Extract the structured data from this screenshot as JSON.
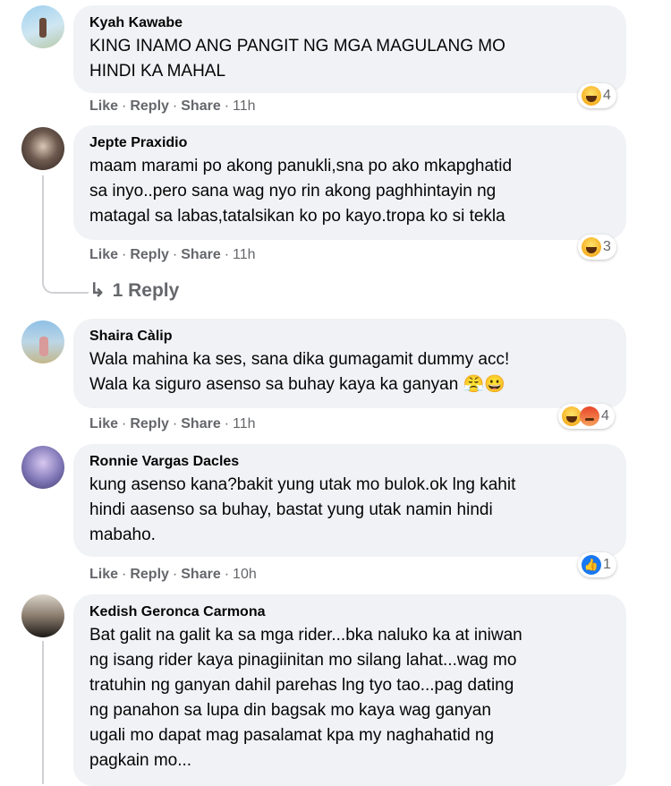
{
  "comments": [
    {
      "name": "Kyah Kawabe",
      "text": "KING INAMO ANG PANGIT NG MGA MAGULANG MO\nHINDI KA MAHAL",
      "like": "Like",
      "reply": "Reply",
      "share": "Share",
      "time": "11h",
      "reaction_count": "4",
      "reaction_icons": [
        "haha-icon"
      ]
    },
    {
      "name": "Jepte Praxidio",
      "text": "maam marami po akong panukli,sna po ako mkapghatid\nsa inyo..pero sana wag nyo rin akong paghhintayin ng\nmatagal sa labas,tatalsikan ko po kayo.tropa ko si tekla",
      "like": "Like",
      "reply": "Reply",
      "share": "Share",
      "time": "11h",
      "reaction_count": "3",
      "reaction_icons": [
        "haha-icon"
      ],
      "replies_label": "1 Reply"
    },
    {
      "name": "Shaira Càlip",
      "text": "Wala mahina ka ses, sana dika gumagamit dummy acc!\nWala ka siguro asenso sa buhay kaya ka ganyan 😤😀",
      "like": "Like",
      "reply": "Reply",
      "share": "Share",
      "time": "11h",
      "reaction_count": "4",
      "reaction_icons": [
        "haha-icon",
        "angry-icon"
      ]
    },
    {
      "name": "Ronnie Vargas Dacles",
      "text": "kung asenso kana?bakit yung utak mo bulok.ok lng kahit\nhindi aasenso sa buhay, bastat yung utak namin hindi\nmabaho.",
      "like": "Like",
      "reply": "Reply",
      "share": "Share",
      "time": "10h",
      "reaction_count": "1",
      "reaction_icons": [
        "like-icon"
      ]
    },
    {
      "name": "Kedish Geronca Carmona",
      "text": "Bat galit na galit ka sa mga rider...bka naluko ka at iniwan\nng isang rider kaya pinagiinitan mo silang lahat...wag mo\ntratuhin ng ganyan dahil parehas lng tyo tao...pag dating\nng panahon sa lupa din bagsak mo kaya wag ganyan\nugali mo dapat mag pasalamat kpa my naghahatid ng\npagkain mo..."
    }
  ],
  "colors": {
    "bubble": "#f0f2f5",
    "meta": "#65676b",
    "like_blue": "#1877f2"
  }
}
